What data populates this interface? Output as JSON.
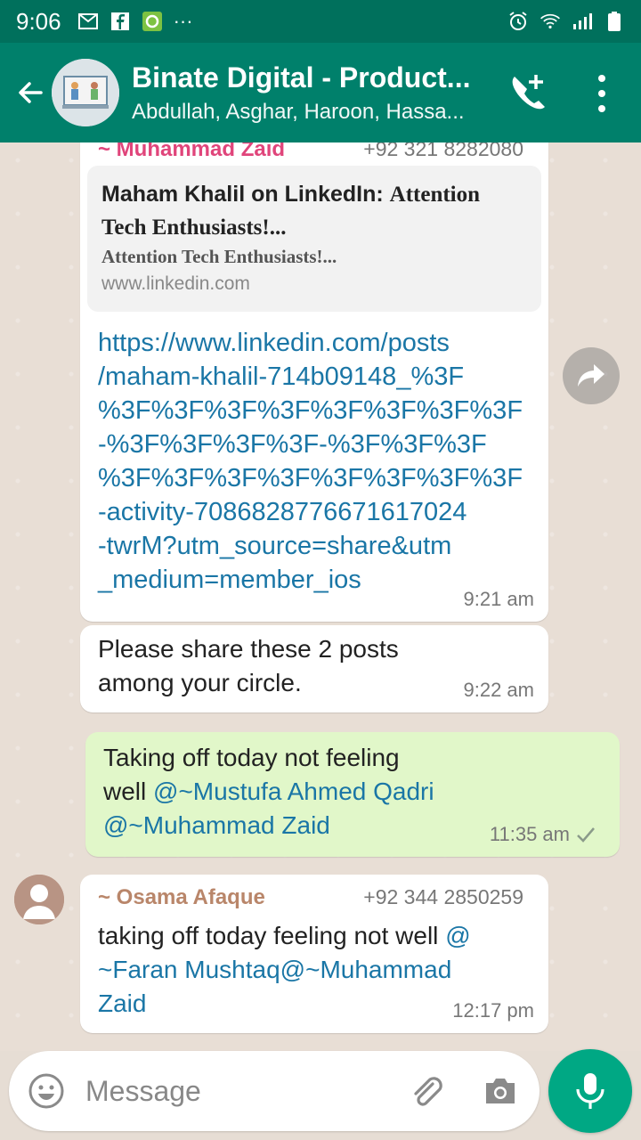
{
  "status": {
    "time": "9:06",
    "dots": "···"
  },
  "header": {
    "title": "Binate Digital - Product...",
    "subtitle": "Abdullah, Asghar, Haroon, Hassa..."
  },
  "messages": [
    {
      "sender": "~ Muhammad Zaid",
      "phone": "+92 321 8282080",
      "preview_title_a": "Maham Khalil on LinkedIn: ",
      "preview_title_b": "Attention",
      "preview_title_c": "Tech Enthusiasts!...",
      "preview_desc": "Attention Tech Enthusiasts!...",
      "preview_url": "www.linkedin.com",
      "link_lines": [
        "https://www.linkedin.com/posts",
        "/maham-khalil-714b09148_%3F",
        "%3F%3F%3F%3F%3F%3F%3F%3F",
        "-%3F%3F%3F%3F-%3F%3F%3F",
        "%3F%3F%3F%3F%3F%3F%3F%3F",
        "-activity-7086828776671617024",
        "-twrM?utm_source=share&utm",
        "_medium=member_ios"
      ],
      "time": "9:21 am"
    },
    {
      "line1": "Please share these 2 posts",
      "line2": "among your circle.",
      "time": "9:22 am"
    },
    {
      "line1": "Taking off today not feeling",
      "line2_text": "well ",
      "mention1": "@~Mustufa Ahmed Qadri",
      "mention2": "@~Muhammad Zaid",
      "time": "11:35 am"
    },
    {
      "sender": "~ Osama Afaque",
      "phone": "+92 344 2850259",
      "text": "taking off today feeling not well ",
      "mention_a": "@",
      "mention_b": "~Faran Mushtaq@~Muhammad",
      "mention_c": "Zaid",
      "time": "12:17 pm"
    }
  ],
  "input": {
    "placeholder": "Message"
  },
  "colors": {
    "header": "#00806b",
    "statusbar": "#00705c",
    "sender1": "#e0457b",
    "sender2": "#b9866a",
    "link": "#1a76a6",
    "outgoing": "#e1f7c9",
    "mic": "#00a884"
  },
  "icons": [
    "back-arrow-icon",
    "group-avatar",
    "call-add-icon",
    "more-vert-icon",
    "forward-icon",
    "emoji-icon",
    "attach-icon",
    "camera-icon",
    "mic-icon",
    "read-tick-icon"
  ]
}
